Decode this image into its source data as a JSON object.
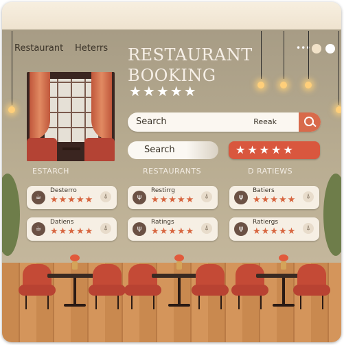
{
  "app": {
    "brand": "Restaurant",
    "brand2": "Heterrs",
    "title_line1": "RESTAURANT",
    "title_line2": "BOOKING",
    "title_stars": "★★★★★"
  },
  "search": {
    "query": "Search",
    "hint": "Reeak",
    "secondary_button": "Search",
    "rating_stars": "★★★★★"
  },
  "columns": [
    {
      "header": "ESTARCH"
    },
    {
      "header": "RESTAURANTS"
    },
    {
      "header": "D RATIEWS"
    }
  ],
  "cards": [
    {
      "name": "Desterro",
      "stars": "★★★★★",
      "icon": "restaurant-logo"
    },
    {
      "name": "Restirrg",
      "stars": "★★★★★",
      "icon": "utensils-icon"
    },
    {
      "name": "Batiers",
      "stars": "★★★★★",
      "icon": "utensils-icon"
    },
    {
      "name": "Datiens",
      "stars": "★★★★★",
      "icon": "restaurant-logo"
    },
    {
      "name": "Ratings",
      "stars": "★★★★★",
      "icon": "utensils-icon"
    },
    {
      "name": "Ratiergs",
      "stars": "★★★★★",
      "icon": "utensils-icon"
    }
  ],
  "colors": {
    "accent": "#d86a4b",
    "star": "#d7653f",
    "card_bg": "#f6efe4"
  }
}
